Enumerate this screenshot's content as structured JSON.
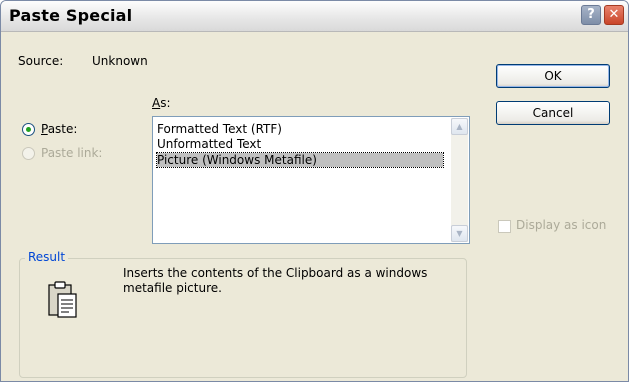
{
  "window": {
    "title": "Paste Special",
    "help_glyph": "?",
    "close_glyph": "✕"
  },
  "source": {
    "label": "Source:",
    "value": "Unknown"
  },
  "as_label": {
    "accel": "A",
    "rest": "s:"
  },
  "options": {
    "paste": {
      "accel": "P",
      "rest": "aste:",
      "checked": true
    },
    "paste_link": {
      "label": "Paste link:",
      "enabled": false
    }
  },
  "list": {
    "items": [
      "Formatted Text (RTF)",
      "Unformatted Text",
      "Picture (Windows Metafile)"
    ],
    "selected_index": 2
  },
  "buttons": {
    "ok": "OK",
    "cancel": "Cancel"
  },
  "display_as_icon": {
    "label": "Display as icon",
    "checked": false,
    "enabled": false
  },
  "result": {
    "legend": "Result",
    "icon": "clipboard-icon",
    "text": "Inserts the contents of the Clipboard as a windows metafile picture."
  },
  "colors": {
    "dialog_bg": "#ece9d8",
    "legend_text": "#0046d5",
    "selection_bg": "#c0c0c0",
    "disabled_text": "#acaa99"
  }
}
